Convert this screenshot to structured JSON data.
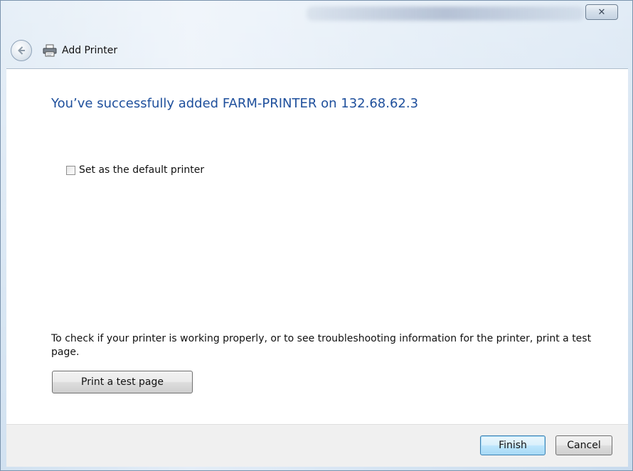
{
  "window": {
    "close_glyph": "✕"
  },
  "nav": {
    "title": "Add Printer"
  },
  "main": {
    "heading": "You’ve successfully added FARM-PRINTER on 132.68.62.3",
    "default_printer_label": "Set as the default printer",
    "default_printer_checked": false,
    "info_text": "To check if your printer is working properly, or to see troubleshooting information for the printer, print a test page.",
    "test_page_button": "Print a test page"
  },
  "footer": {
    "finish_label": "Finish",
    "cancel_label": "Cancel"
  },
  "colors": {
    "heading": "#1e4f9c",
    "default_button_border": "#3c7fb1"
  },
  "icons": [
    "back-arrow-icon",
    "printer-icon",
    "close-icon"
  ]
}
